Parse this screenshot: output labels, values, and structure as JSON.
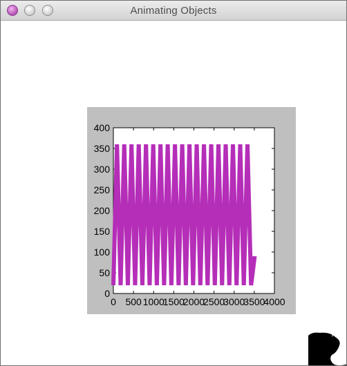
{
  "window": {
    "title": "Animating Objects",
    "controls": [
      "close-button",
      "minimize-button",
      "zoom-button"
    ]
  },
  "colors": {
    "figure_bg": "#bfbfbf",
    "plot_bg": "#ffffff",
    "line": "#b52eb8"
  },
  "chart_data": {
    "type": "line",
    "title": "",
    "xlabel": "",
    "ylabel": "",
    "xlim": [
      0,
      4000
    ],
    "ylim": [
      0,
      400
    ],
    "x_ticks": [
      "0",
      "500",
      "1000",
      "1500",
      "2000",
      "2500",
      "3000",
      "3500",
      "4000"
    ],
    "y_ticks": [
      "0",
      "50",
      "100",
      "150",
      "200",
      "250",
      "300",
      "350",
      "400"
    ],
    "grid": false,
    "series": [
      {
        "x": [
          0,
          90,
          180,
          270,
          360,
          450,
          540,
          630,
          720,
          810,
          900,
          990,
          1080,
          1170,
          1260,
          1350,
          1440,
          1530,
          1620,
          1710,
          1800,
          1890,
          1980,
          2070,
          2160,
          2250,
          2340,
          2430,
          2520,
          2610,
          2700,
          2790,
          2880,
          2970,
          3060,
          3150,
          3240,
          3330,
          3420,
          3510
        ],
        "y": [
          20,
          360,
          20,
          360,
          20,
          360,
          20,
          360,
          20,
          360,
          20,
          360,
          20,
          360,
          20,
          360,
          20,
          360,
          20,
          360,
          20,
          360,
          20,
          360,
          20,
          360,
          20,
          360,
          20,
          360,
          20,
          360,
          20,
          360,
          20,
          360,
          20,
          360,
          20,
          90
        ]
      }
    ]
  }
}
